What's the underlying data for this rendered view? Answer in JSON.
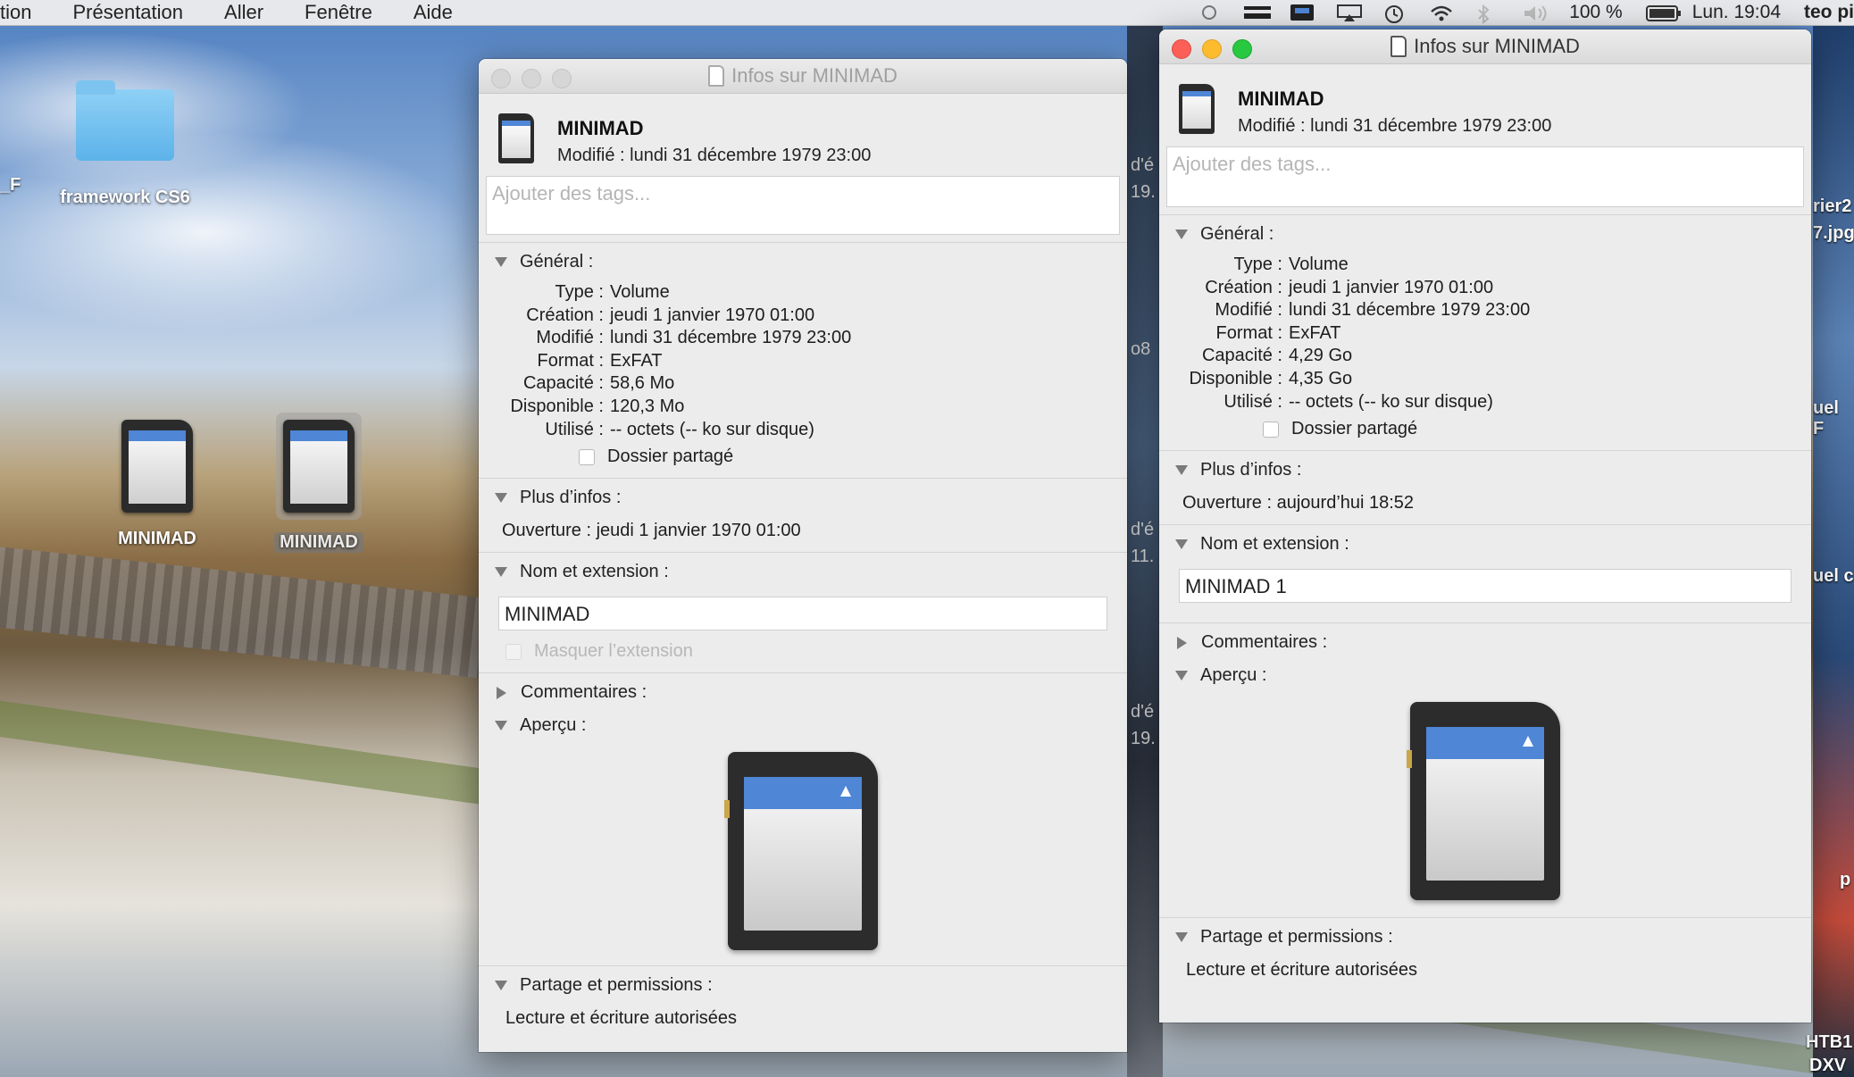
{
  "menubar": {
    "items": [
      "tion",
      "Présentation",
      "Aller",
      "Fenêtre",
      "Aide"
    ],
    "battery": "100 %",
    "clock": "Lun. 19:04",
    "user": "teo pi"
  },
  "desktop": {
    "icons": [
      {
        "label": "framework CS6",
        "icon": "folder-icon"
      },
      {
        "label": "MINIMAD",
        "icon": "sd-card-icon"
      },
      {
        "label": "MINIMAD",
        "icon": "sd-card-icon",
        "selected": true
      }
    ],
    "edge_texts": [
      "_F",
      "d'é",
      "19.",
      "o8",
      "d'é",
      "11.",
      "d'é",
      "19.",
      "rier2",
      "7.jpg",
      "uel F",
      "uel c",
      "p",
      "HTB1",
      "DXV"
    ]
  },
  "window_left": {
    "title": "Infos sur MINIMAD",
    "name": "MINIMAD",
    "modified_line": "Modifié :  lundi 31 décembre 1979 23:00",
    "tags_placeholder": "Ajouter des tags...",
    "general": {
      "heading": "Général :",
      "rows": [
        {
          "k": "Type :",
          "v": "Volume"
        },
        {
          "k": "Création :",
          "v": "jeudi 1 janvier 1970 01:00"
        },
        {
          "k": "Modifié :",
          "v": "lundi 31 décembre 1979 23:00"
        },
        {
          "k": "Format :",
          "v": "ExFAT"
        },
        {
          "k": "Capacité :",
          "v": "58,6 Mo"
        },
        {
          "k": "Disponible :",
          "v": "120,3 Mo"
        },
        {
          "k": "Utilisé :",
          "v": "-- octets (-- ko sur disque)"
        }
      ],
      "shared_label": "Dossier partagé"
    },
    "more_info": {
      "heading": "Plus d’infos :",
      "line": "Ouverture : jeudi 1 janvier 1970 01:00"
    },
    "name_ext": {
      "heading": "Nom et extension :",
      "value": "MINIMAD",
      "hide_ext_label": "Masquer l’extension"
    },
    "comments": {
      "heading": "Commentaires :"
    },
    "preview": {
      "heading": "Aperçu :"
    },
    "sharing": {
      "heading": "Partage et permissions :",
      "line": "Lecture et écriture autorisées"
    }
  },
  "window_right": {
    "title": "Infos sur MINIMAD",
    "name": "MINIMAD",
    "modified_line": "Modifié :  lundi 31 décembre 1979 23:00",
    "tags_placeholder": "Ajouter des tags...",
    "general": {
      "heading": "Général :",
      "rows": [
        {
          "k": "Type :",
          "v": "Volume"
        },
        {
          "k": "Création :",
          "v": "jeudi 1 janvier 1970 01:00"
        },
        {
          "k": "Modifié :",
          "v": "lundi 31 décembre 1979 23:00"
        },
        {
          "k": "Format :",
          "v": "ExFAT"
        },
        {
          "k": "Capacité :",
          "v": "4,29 Go"
        },
        {
          "k": "Disponible :",
          "v": "4,35 Go"
        },
        {
          "k": "Utilisé :",
          "v": "-- octets (-- ko sur disque)"
        }
      ],
      "shared_label": "Dossier partagé"
    },
    "more_info": {
      "heading": "Plus d’infos :",
      "line": "Ouverture : aujourd’hui 18:52"
    },
    "name_ext": {
      "heading": "Nom et extension :",
      "value": "MINIMAD 1"
    },
    "comments": {
      "heading": "Commentaires :"
    },
    "preview": {
      "heading": "Aperçu :"
    },
    "sharing": {
      "heading": "Partage et permissions :",
      "line": "Lecture et écriture autorisées"
    }
  },
  "colors": {
    "accent_blue": "#4f86d6",
    "close_red": "#fc5f57",
    "minimize_yellow": "#fdbc2e",
    "zoom_green": "#28c840"
  }
}
